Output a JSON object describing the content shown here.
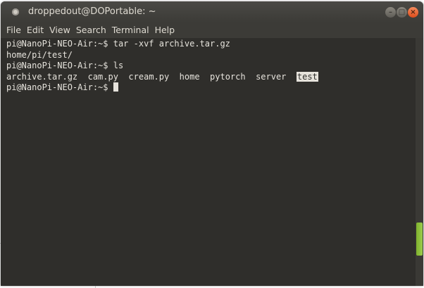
{
  "window": {
    "title": "droppedout@DOPortable: ~",
    "controls": {
      "minimize": "–",
      "maximize": "□",
      "close": "×"
    }
  },
  "menubar": {
    "items": [
      "File",
      "Edit",
      "View",
      "Search",
      "Terminal",
      "Help"
    ]
  },
  "terminal": {
    "prompt": "pi@NanoPi-NEO-Air:~$",
    "lines": [
      {
        "kind": "command",
        "text": "tar -xvf archive.tar.gz"
      },
      {
        "kind": "output",
        "text": "home/pi/test/"
      },
      {
        "kind": "command",
        "text": "ls"
      }
    ],
    "ls_output": [
      "archive.tar.gz",
      "cam.py",
      "cream.py",
      "home",
      "pytorch",
      "server",
      "test"
    ],
    "ls_highlighted": "test"
  },
  "scrollbar": {
    "position_fraction": 0.86
  },
  "colors": {
    "terminal_bg": "#2f2e2b",
    "terminal_fg": "#e6e3dc",
    "titlebar": "#3c3b37",
    "close_button": "#dd4c1b",
    "scroll_thumb": "#8bc34a"
  }
}
